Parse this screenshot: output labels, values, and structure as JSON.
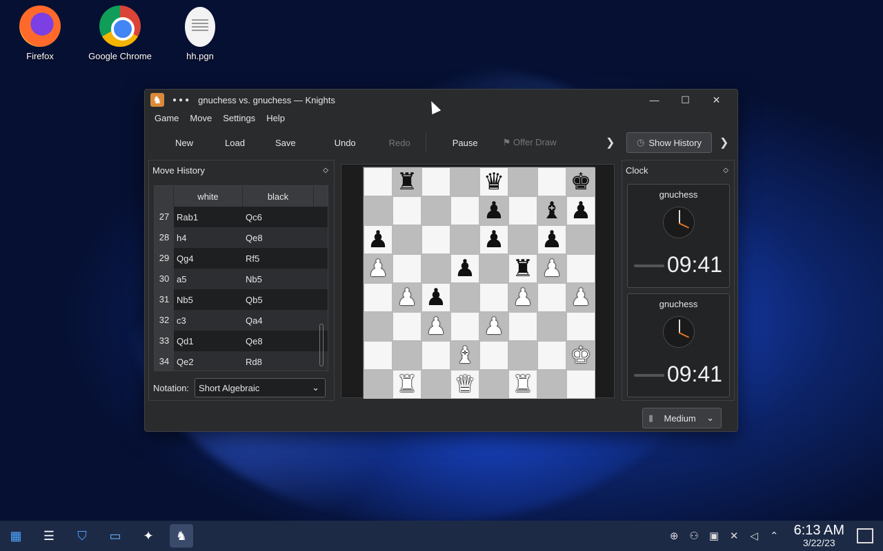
{
  "desktop": {
    "icons": [
      {
        "label": "Firefox",
        "icon": "firefox-icon"
      },
      {
        "label": "Google Chrome",
        "icon": "chrome-icon"
      },
      {
        "label": "hh.pgn",
        "icon": "file-icon"
      }
    ]
  },
  "window": {
    "title": "gnuchess vs. gnuchess — Knights",
    "menu": [
      "Game",
      "Move",
      "Settings",
      "Help"
    ],
    "toolbar": {
      "new": "New",
      "load": "Load",
      "save": "Save",
      "undo": "Undo",
      "redo": "Redo",
      "pause": "Pause",
      "offer_draw": "Offer Draw",
      "show_history": "Show History"
    }
  },
  "history": {
    "title": "Move History",
    "columns": [
      "white",
      "black"
    ],
    "rows": [
      {
        "n": "27",
        "white": "Rab1",
        "black": "Qc6"
      },
      {
        "n": "28",
        "white": "h4",
        "black": "Qe8"
      },
      {
        "n": "29",
        "white": "Qg4",
        "black": "Rf5"
      },
      {
        "n": "30",
        "white": "a5",
        "black": "Nb5"
      },
      {
        "n": "31",
        "white": "Nb5",
        "black": "Qb5"
      },
      {
        "n": "32",
        "white": "c3",
        "black": "Qa4"
      },
      {
        "n": "33",
        "white": "Qd1",
        "black": "Qe8"
      },
      {
        "n": "34",
        "white": "Qe2",
        "black": "Rd8"
      }
    ],
    "notation_label": "Notation:",
    "notation_value": "Short Algebraic"
  },
  "board": [
    [
      "",
      "bR",
      "",
      "",
      "bQ",
      "",
      "",
      "bK"
    ],
    [
      "",
      "",
      "",
      "",
      "bP",
      "",
      "bB",
      "bP"
    ],
    [
      "bP",
      "",
      "",
      "",
      "bP",
      "",
      "bP",
      ""
    ],
    [
      "wP",
      "",
      "",
      "bP",
      "",
      "bR",
      "wP",
      ""
    ],
    [
      "",
      "wP",
      "bP",
      "",
      "",
      "wP",
      "",
      "wP"
    ],
    [
      "",
      "",
      "wP",
      "",
      "wP",
      "",
      "",
      ""
    ],
    [
      "",
      "",
      "",
      "wB",
      "",
      "",
      "",
      "wK"
    ],
    [
      "",
      "wR",
      "",
      "wQ",
      "",
      "wR",
      "",
      ""
    ]
  ],
  "clock": {
    "title": "Clock",
    "players": [
      {
        "name": "gnuchess",
        "time": "09:41"
      },
      {
        "name": "gnuchess",
        "time": "09:41"
      }
    ],
    "difficulty": "Medium"
  },
  "taskbar": {
    "time": "6:13 AM",
    "date": "3/22/23"
  }
}
